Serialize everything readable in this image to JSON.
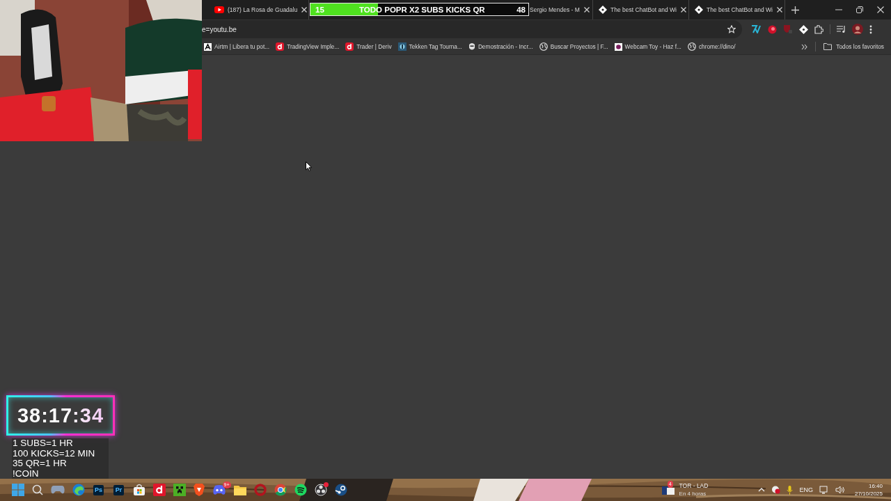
{
  "browser": {
    "tabs": [
      {
        "title": "(187) La Rosa de Guadalu",
        "kind": "youtube",
        "selected": false
      },
      {
        "title": "Sergio Mendes - M",
        "kind": "plain",
        "selected": false
      },
      {
        "title": "The best ChatBot and Wi",
        "kind": "diamond",
        "selected": false
      },
      {
        "title": "The best ChatBot and Wi",
        "kind": "diamond",
        "selected": false
      }
    ],
    "address": "e=youtu.be",
    "bookmarks": [
      {
        "label": "Airtm | Libera tu pot...",
        "kind": "letter-tile"
      },
      {
        "label": "TradingView Imple...",
        "kind": "red-d"
      },
      {
        "label": "Trader | Deriv",
        "kind": "red-d"
      },
      {
        "label": "Tekken Tag Tourna...",
        "kind": "game-thumb"
      },
      {
        "label": "Demostración - Incr...",
        "kind": "mask"
      },
      {
        "label": "Buscar Proyectos | F...",
        "kind": "globe"
      },
      {
        "label": "Webcam Toy - Haz f...",
        "kind": "webcam"
      },
      {
        "label": "chrome://dino/",
        "kind": "globe"
      }
    ],
    "all_bookmarks": "Todos los favoritos"
  },
  "overlay": {
    "goal": {
      "count": "15",
      "title": "TODO POPR X2 SUBS KICKS QR",
      "target": "48",
      "level": 0.31
    },
    "timer": "38:17:34",
    "rules": [
      "1 SUBS=1 HR",
      "100 KICKS=12 MIN",
      "35 QR=1 HR",
      "!COIN"
    ]
  },
  "taskbar": {
    "apps": [
      {
        "kind": "start"
      },
      {
        "kind": "search"
      },
      {
        "kind": "gamepad"
      },
      {
        "kind": "swirl"
      },
      {
        "kind": "tile",
        "label": "Ps"
      },
      {
        "kind": "tile",
        "label": "Pr"
      },
      {
        "kind": "bag"
      },
      {
        "kind": "red-d"
      },
      {
        "kind": "creeper"
      },
      {
        "kind": "lion"
      },
      {
        "kind": "chat",
        "badge": "9+"
      },
      {
        "kind": "folder"
      },
      {
        "kind": "ring"
      },
      {
        "kind": "chrome"
      },
      {
        "kind": "spotify"
      },
      {
        "kind": "obs"
      },
      {
        "kind": "steam"
      }
    ],
    "weather": {
      "badge": "4",
      "title": "TOR - LAD",
      "subtitle": "En 4 horas"
    },
    "language": "ENG",
    "time": "16:40",
    "date": "27/10/2025"
  }
}
